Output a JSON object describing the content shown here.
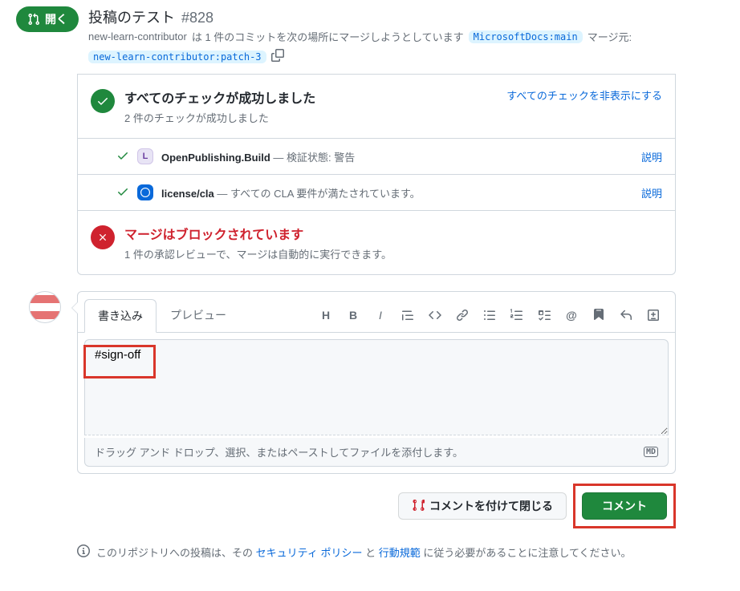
{
  "header": {
    "state_label": "開く",
    "title": "投稿のテスト",
    "number": "#828",
    "author": "new-learn-contributor",
    "wants_merge_text": "は 1 件のコミットを次の場所にマージしようとしています",
    "base_branch": "MicrosoftDocs:main",
    "merge_from_label": "マージ元:",
    "head_branch": "new-learn-contributor:patch-3"
  },
  "checks": {
    "success_title": "すべてのチェックが成功しました",
    "success_sub": "2 件のチェックが成功しました",
    "hide_link": "すべてのチェックを非表示にする",
    "items": [
      {
        "name": "OpenPublishing.Build",
        "desc": " — 検証状態: 警告",
        "detail": "説明"
      },
      {
        "name": "license/cla",
        "desc": " — すべての CLA 要件が満たされています。",
        "detail": "説明"
      }
    ],
    "blocked_title": "マージはブロックされています",
    "blocked_sub": "1 件の承認レビューで、マージは自動的に実行できます。"
  },
  "comment": {
    "tab_write": "書き込み",
    "tab_preview": "プレビュー",
    "textarea_value": "#sign-off",
    "attach_hint": "ドラッグ アンド ドロップ、選択、またはペーストしてファイルを添付します。",
    "md_label": "MD"
  },
  "actions": {
    "close_label": "コメントを付けて閉じる",
    "comment_label": "コメント"
  },
  "footer": {
    "prefix": "このリポジトリへの投稿は、その ",
    "link1": "セキュリティ ポリシー",
    "mid": " と ",
    "link2": "行動規範",
    "suffix": " に従う必要があることに注意してください。"
  }
}
